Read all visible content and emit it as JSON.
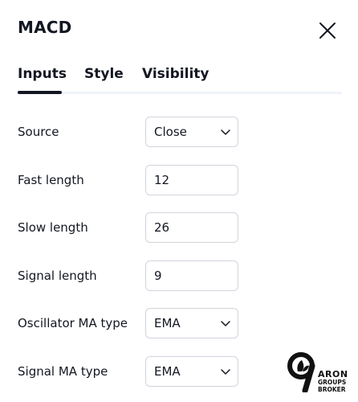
{
  "dialog": {
    "title": "MACD",
    "close_icon": "close-icon"
  },
  "tabs": [
    {
      "label": "Inputs",
      "active": true
    },
    {
      "label": "Style",
      "active": false
    },
    {
      "label": "Visibility",
      "active": false
    }
  ],
  "inputs": {
    "source": {
      "label": "Source",
      "value": "Close",
      "type": "select"
    },
    "fast_length": {
      "label": "Fast length",
      "value": "12",
      "type": "number"
    },
    "slow_length": {
      "label": "Slow length",
      "value": "26",
      "type": "number"
    },
    "signal_length": {
      "label": "Signal length",
      "value": "9",
      "type": "number"
    },
    "oscillator_ma_type": {
      "label": "Oscillator MA type",
      "value": "EMA",
      "type": "select"
    },
    "signal_ma_type": {
      "label": "Signal MA type",
      "value": "EMA",
      "type": "select"
    }
  },
  "watermark": {
    "line1": "ARON",
    "line2": "GROUPS",
    "line3": "BROKER"
  },
  "colors": {
    "text": "#131722",
    "border": "#d1d4dc",
    "tab_track": "#f0f3fa",
    "active_tab_underline": "#131722"
  }
}
